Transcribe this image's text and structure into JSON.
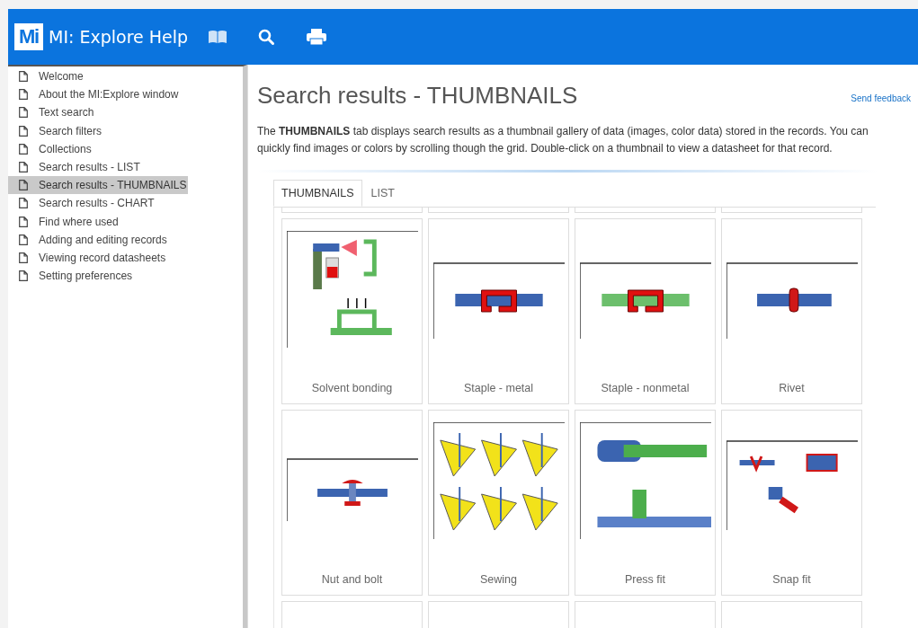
{
  "header": {
    "logo": "Mi",
    "title": "MI: Explore Help"
  },
  "sidebar": {
    "items": [
      {
        "label": "Welcome",
        "selected": false
      },
      {
        "label": "About the MI:Explore window",
        "selected": false
      },
      {
        "label": "Text search",
        "selected": false
      },
      {
        "label": "Search filters",
        "selected": false
      },
      {
        "label": "Collections",
        "selected": false
      },
      {
        "label": "Search results - LIST",
        "selected": false
      },
      {
        "label": "Search results - THUMBNAILS",
        "selected": true
      },
      {
        "label": "Search results - CHART",
        "selected": false
      },
      {
        "label": "Find where used",
        "selected": false
      },
      {
        "label": "Adding and editing records",
        "selected": false
      },
      {
        "label": "Viewing record datasheets",
        "selected": false
      },
      {
        "label": "Setting preferences",
        "selected": false
      }
    ]
  },
  "content": {
    "title": "Search results - THUMBNAILS",
    "feedback_link": "Send feedback",
    "intro": "The **THUMBNAILS** tab displays search results as a thumbnail gallery of data (images, color data) stored in the records. You can quickly find images or colors by scrolling though the grid. Double-click on a thumbnail to view a datasheet for that record.",
    "tabs": [
      {
        "label": "THUMBNAILS",
        "selected": true
      },
      {
        "label": "LIST",
        "selected": false
      }
    ],
    "thumbnails": [
      {
        "label": "Solvent bonding"
      },
      {
        "label": "Staple - metal"
      },
      {
        "label": "Staple - nonmetal"
      },
      {
        "label": "Rivet"
      },
      {
        "label": "Nut and bolt"
      },
      {
        "label": "Sewing"
      },
      {
        "label": "Press fit"
      },
      {
        "label": "Snap fit"
      }
    ]
  }
}
